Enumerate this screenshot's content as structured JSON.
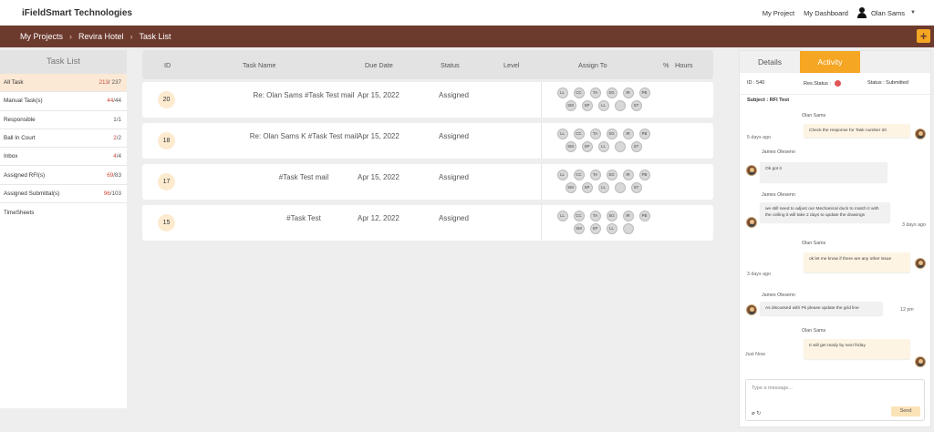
{
  "app": {
    "brand": "iFieldSmart Technologies"
  },
  "header": {
    "my_project": "My Project",
    "my_dashboard": "My Dashboard",
    "user_name": "Olan Sams"
  },
  "breadcrumb": {
    "items": [
      "My Projects",
      "Revira Hotel",
      "Task List"
    ],
    "add_label": "+"
  },
  "sidebar": {
    "title": "Task List",
    "items": [
      {
        "label": "All Task",
        "count_a": "213",
        "count_b": "/ 237"
      },
      {
        "label": "Manual Task(s)",
        "count_a": "44",
        "count_b": "/44"
      },
      {
        "label": "Responsible",
        "count_a": "",
        "count_b": "1/1"
      },
      {
        "label": "Ball In Court",
        "count_a": "2",
        "count_b": "/2"
      },
      {
        "label": "Inbox",
        "count_a": "4",
        "count_b": "/4"
      },
      {
        "label": "Assigned RFI(s)",
        "count_a": "69",
        "count_b": "/83"
      },
      {
        "label": "Assigned Submittal(s)",
        "count_a": "96",
        "count_b": "/103"
      },
      {
        "label": "TimeSheets",
        "count_a": "",
        "count_b": ""
      }
    ]
  },
  "table": {
    "headers": {
      "id": "ID",
      "name": "Task Name",
      "due": "Due Date",
      "status": "Status",
      "level": "Level",
      "assign": "Assign To",
      "pct": "%",
      "hours": "Hours"
    },
    "rows": [
      {
        "id": "20",
        "name": "Re: Olan Sams #Task Test mail",
        "due": "Apr 15, 2022",
        "status": "Assigned",
        "chips": [
          "LL",
          "CC",
          "TA",
          "SG",
          "IR",
          "PB",
          "SM",
          "SP",
          "LL",
          "",
          "ST"
        ]
      },
      {
        "id": "18",
        "name": "Re: Olan Sams K #Task Test mail",
        "due": "Apr 15, 2022",
        "status": "Assigned",
        "chips": [
          "LL",
          "CC",
          "TA",
          "SG",
          "IR",
          "PB",
          "SM",
          "SP",
          "LL",
          "",
          "ST"
        ]
      },
      {
        "id": "17",
        "name": "#Task Test mail",
        "due": "Apr 15, 2022",
        "status": "Assigned",
        "chips": [
          "LL",
          "CC",
          "TA",
          "SG",
          "IR",
          "PB",
          "SM",
          "SP",
          "LL",
          "",
          "ST"
        ]
      },
      {
        "id": "15",
        "name": "#Task Test",
        "due": "Apr 12, 2022",
        "status": "Assigned",
        "chips": [
          "LL",
          "CC",
          "TA",
          "SG",
          "IR",
          "PB",
          "SM",
          "SP",
          "LL",
          ""
        ]
      }
    ]
  },
  "panel": {
    "tabs": [
      "Details",
      "Activity"
    ],
    "meta": {
      "id": "ID : 540",
      "res_status": "Res.Status :",
      "status": "Status : Submitted"
    },
    "subject": "Subject : RFI Test",
    "messages": [
      {
        "sender": "Olan Sams",
        "text": "Check the response for Task number 20",
        "time": "5 days ago"
      },
      {
        "sender": "James Olesenn",
        "text": "Ok got it",
        "time": ""
      },
      {
        "sender": "James Olesenn",
        "text": "we still need to adjust our Mechanical duck to match it with the ceiling it will take 2 days to update the drawings",
        "time": "3 days ago"
      },
      {
        "sender": "Olan Sams",
        "text": "ok let me know if there are any other issue",
        "time": "3 days ago"
      },
      {
        "sender": "James Olesenn",
        "text": "As discussed with Pk please update the grid line",
        "time": "12 pm"
      },
      {
        "sender": "Olan Sams",
        "text": "It will get ready by next friday",
        "time": "Just Now"
      }
    ],
    "composer": {
      "placeholder": "Type a message...",
      "send": "Send"
    }
  }
}
